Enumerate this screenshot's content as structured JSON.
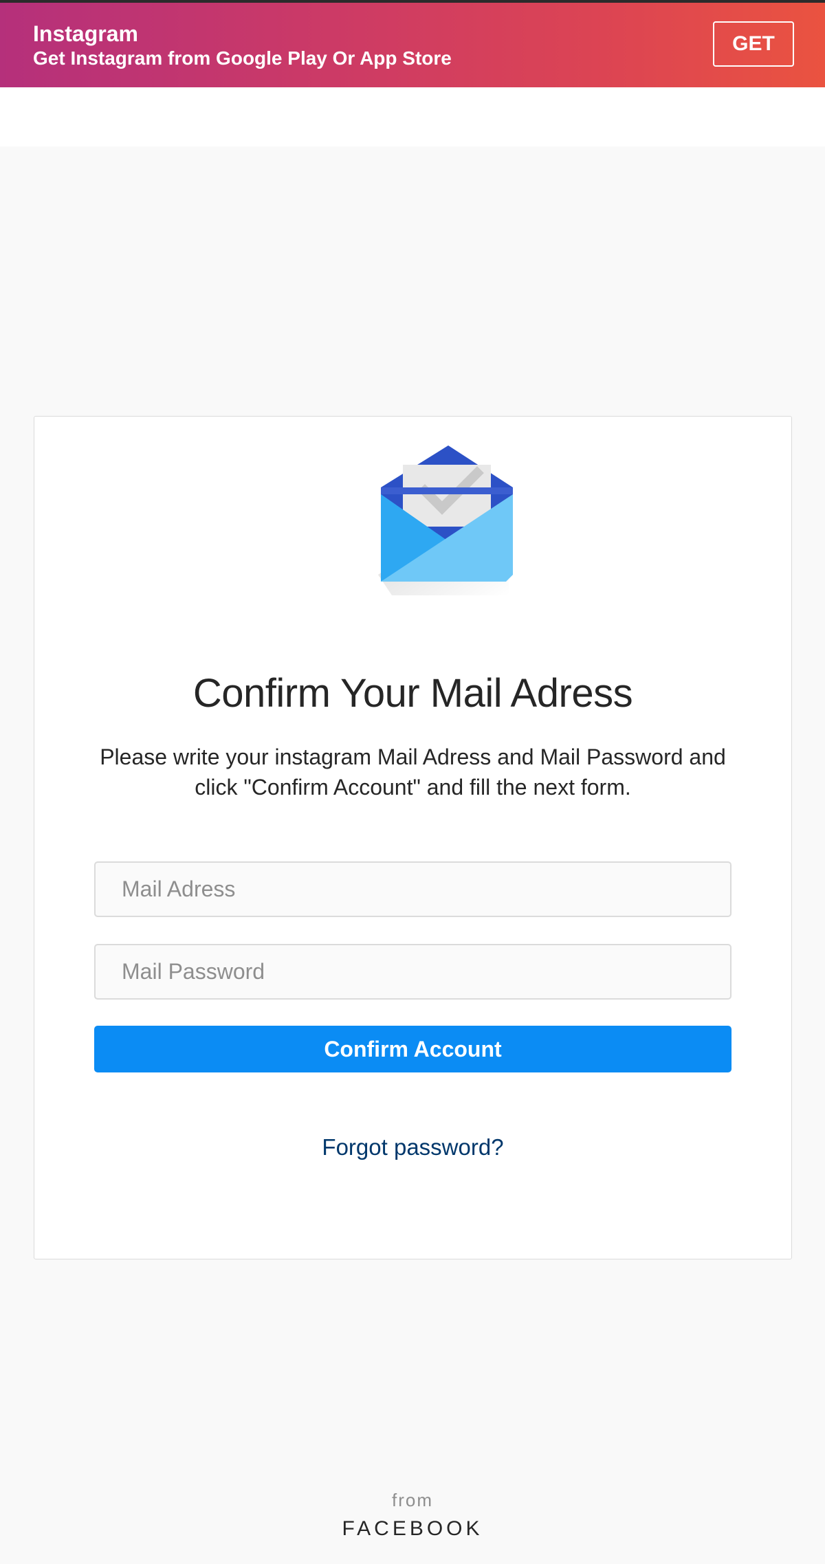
{
  "banner": {
    "title": "Instagram",
    "subtitle": "Get Instagram from Google Play Or App Store",
    "get_label": "GET",
    "gradient_colors": [
      "#b5307b",
      "#ea5340"
    ]
  },
  "card": {
    "icon": "inbox-envelope-check-icon",
    "title": "Confirm Your Mail Adress",
    "description": "Please write your instagram Mail Adress and Mail Password and click \"Confirm Account\" and fill the next form.",
    "mail_field": {
      "placeholder": "Mail Adress",
      "value": ""
    },
    "password_field": {
      "placeholder": "Mail Password",
      "value": ""
    },
    "confirm_label": "Confirm Account",
    "confirm_color": "#0b8cf4",
    "forgot_label": "Forgot password?",
    "link_color": "#00376b"
  },
  "footer": {
    "from": "from",
    "brand": "FACEBOOK"
  }
}
